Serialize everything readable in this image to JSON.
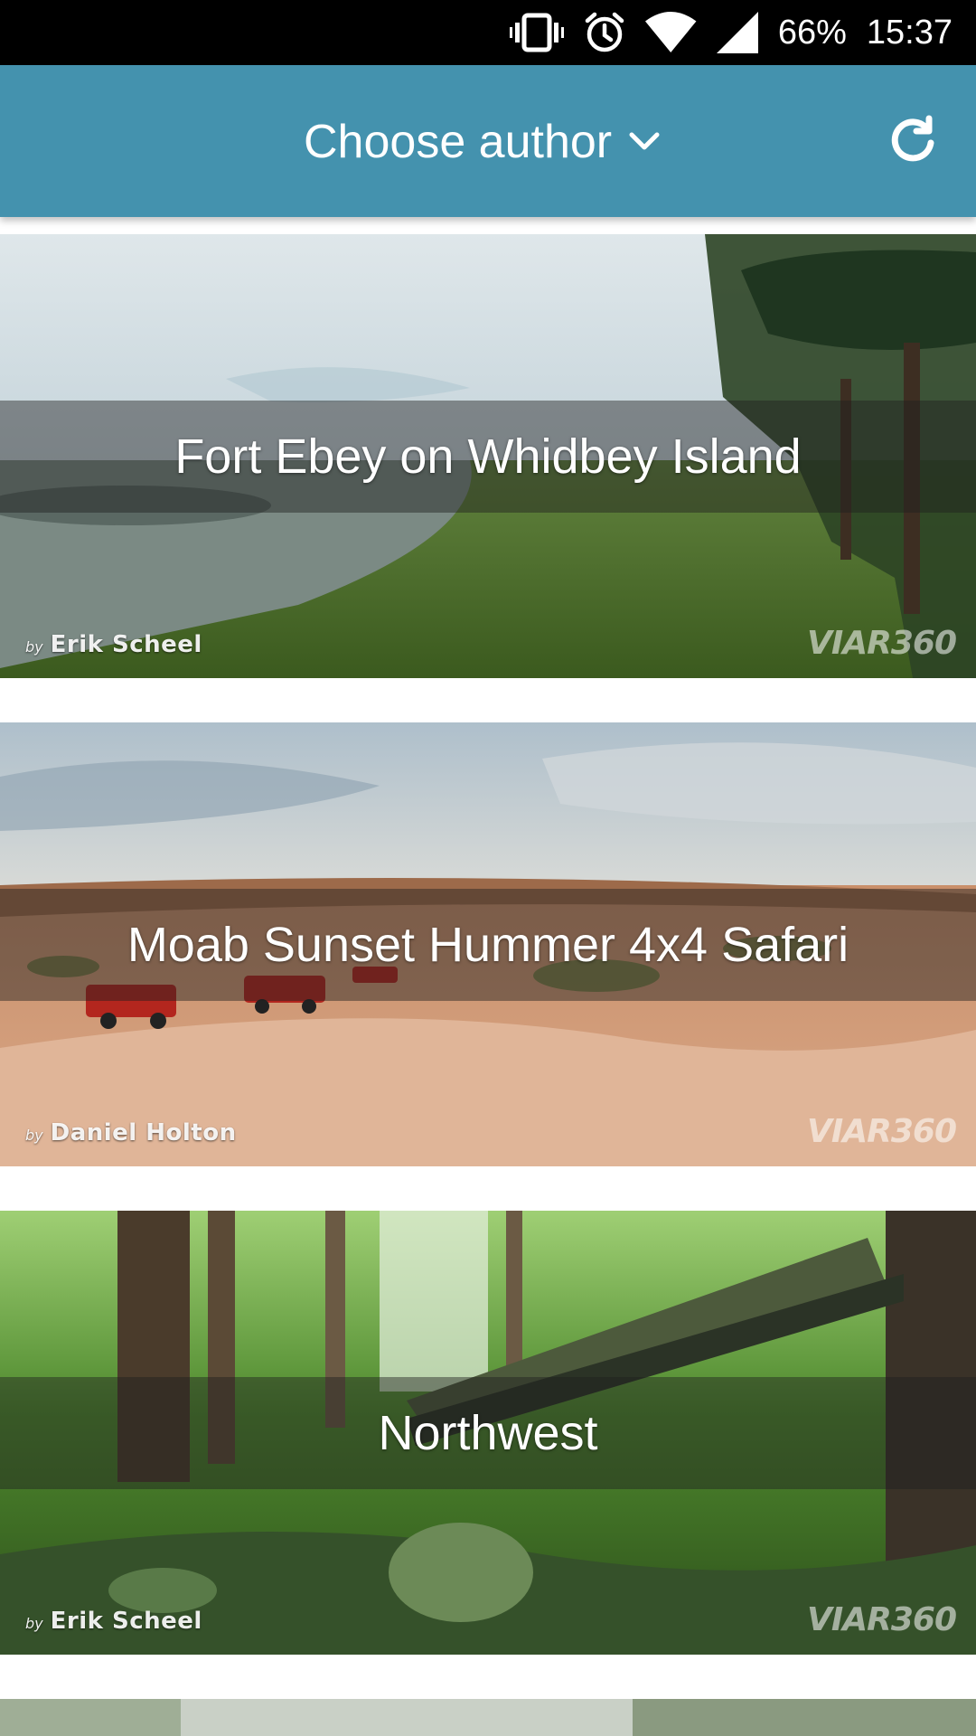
{
  "status_bar": {
    "battery": "66%",
    "time": "15:37",
    "icons": [
      "vibrate-icon",
      "alarm-icon",
      "wifi-icon",
      "signal-icon"
    ]
  },
  "app_bar": {
    "author_selector_label": "Choose author",
    "chevron_icon": "chevron-down-icon",
    "refresh_icon": "refresh-icon",
    "background_color": "#4492AE"
  },
  "tours": [
    {
      "title": "Fort Ebey on Whidbey Island",
      "by": "by",
      "author": "Erik Scheel",
      "watermark": "VIAR360"
    },
    {
      "title": "Moab Sunset Hummer 4x4 Safari",
      "by": "by",
      "author": "Daniel Holton",
      "watermark": "VIAR360"
    },
    {
      "title": "Northwest",
      "by": "by",
      "author": "Erik Scheel",
      "watermark": "VIAR360"
    }
  ]
}
